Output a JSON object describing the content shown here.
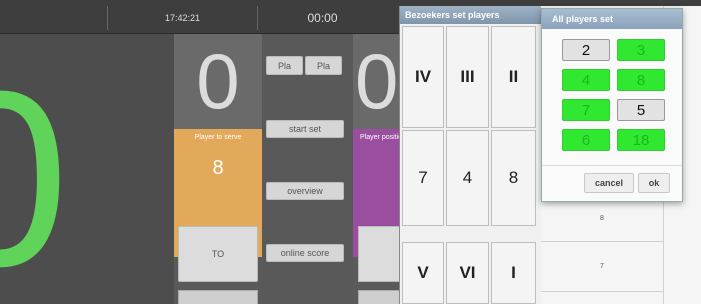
{
  "header": {
    "clock": "17:42:21",
    "timer": "00:00"
  },
  "home": {
    "big_score": "0",
    "set_score": "0",
    "serve_label": "Player to serve",
    "serve_number": "8",
    "to_label": "TO"
  },
  "middle": {
    "pla_left": "Pla",
    "pla_right": "Pla",
    "start_set": "start  set",
    "overview": "overview",
    "online_score": "online score"
  },
  "away": {
    "set_score": "0",
    "label": "Player position",
    "to_label": "T"
  },
  "bezoekers": {
    "title": "Bezoekers set players",
    "cells": [
      "IV",
      "III",
      "II",
      "7",
      "4",
      "8",
      "V",
      "VI",
      "I"
    ]
  },
  "background_table": {
    "header_letter": "e",
    "rows": [
      "8",
      "7"
    ]
  },
  "dialog": {
    "title": "All players set",
    "players": [
      "2",
      "3",
      "4",
      "8",
      "7",
      "5",
      "6",
      "18"
    ],
    "cancel": "cancel",
    "ok": "ok"
  },
  "colors": {
    "green": "#2fe82f",
    "orange": "#e3a95a",
    "purple": "#9a4ea0",
    "big_score": "#5fd35a"
  }
}
